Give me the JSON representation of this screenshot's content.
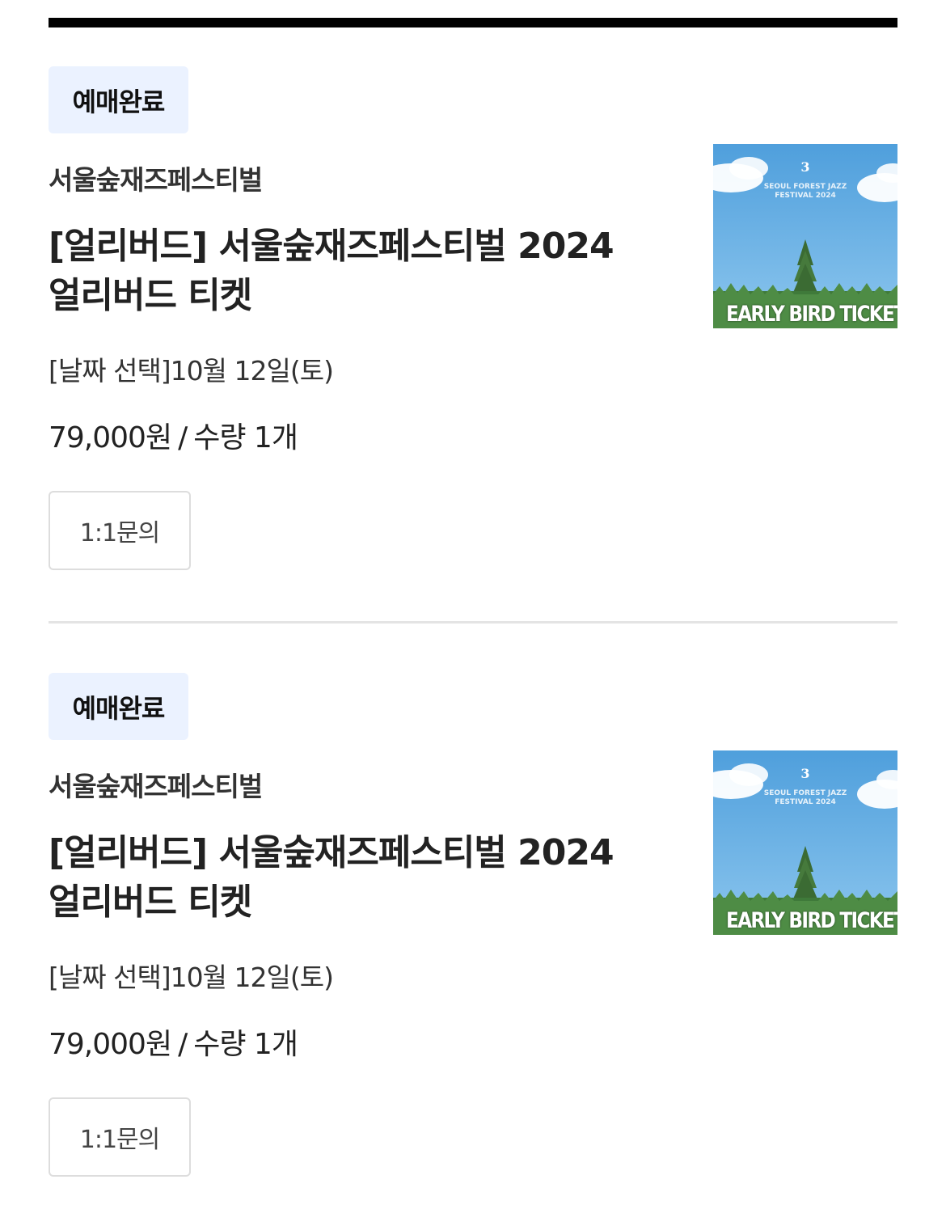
{
  "orders": [
    {
      "status_badge": "예매완료",
      "seller": "서울숲재즈페스티벌",
      "title_line1": "[얼리버드] 서울숲재즈페스티벌 2024",
      "title_line2": "얼리버드 티켓",
      "option": "[날짜 선택]10월 12일(토)",
      "price": "79,000원",
      "separator": "/",
      "quantity": "수량 1개",
      "inquiry_button": "1:1문의",
      "thumbnail": {
        "caption": "EARLY BIRD TICKET",
        "subtitle_line1": "SEOUL FOREST JAZZ",
        "subtitle_line2": "FESTIVAL 2024"
      }
    },
    {
      "status_badge": "예매완료",
      "seller": "서울숲재즈페스티벌",
      "title_line1": "[얼리버드] 서울숲재즈페스티벌 2024",
      "title_line2": "얼리버드 티켓",
      "option": "[날짜 선택]10월 12일(토)",
      "price": "79,000원",
      "separator": "/",
      "quantity": "수량 1개",
      "inquiry_button": "1:1문의",
      "thumbnail": {
        "caption": "EARLY BIRD TICKET",
        "subtitle_line1": "SEOUL FOREST JAZZ",
        "subtitle_line2": "FESTIVAL 2024"
      }
    }
  ],
  "colors": {
    "badge_background": "#ebf2ff",
    "top_rule": "#000000",
    "divider": "#e4e4e4",
    "sky": "#5fa8e0",
    "forest": "#3f7a3a"
  }
}
